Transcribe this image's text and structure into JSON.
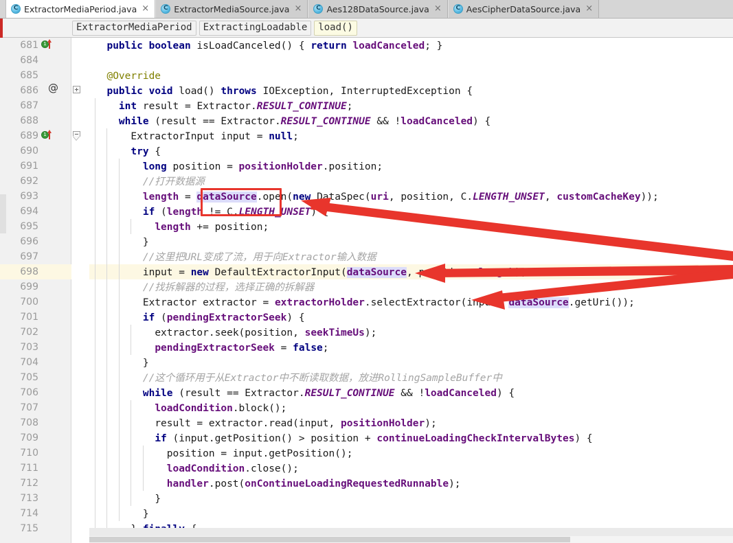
{
  "window": {
    "app": "IntelliJ IDEA Editor",
    "file": "ExtractorMediaPeriod.java"
  },
  "tabs": [
    {
      "label": "ExtractorMediaPeriod.java",
      "icon": "java-class-icon",
      "close": "×",
      "active": true
    },
    {
      "label": "ExtractorMediaSource.java",
      "icon": "java-class-icon",
      "close": "×",
      "active": false
    },
    {
      "label": "Aes128DataSource.java",
      "icon": "java-class-icon",
      "close": "×",
      "active": false
    },
    {
      "label": "AesCipherDataSource.java",
      "icon": "java-class-icon",
      "close": "×",
      "active": false
    }
  ],
  "breadcrumb": [
    {
      "label": "ExtractorMediaPeriod",
      "current": false
    },
    {
      "label": "ExtractingLoadable",
      "current": false
    },
    {
      "label": "load()",
      "current": true
    }
  ],
  "gutter": {
    "line_numbers": [
      "681",
      "684",
      "685",
      "686",
      "687",
      "688",
      "689",
      "690",
      "691",
      "692",
      "693",
      "694",
      "695",
      "696",
      "697",
      "698",
      "699",
      "700",
      "701",
      "702",
      "703",
      "704",
      "705",
      "706",
      "707",
      "708",
      "709",
      "710",
      "711",
      "712",
      "713",
      "714",
      "715"
    ],
    "icons": {
      "line_681": [
        "implementing-method-icon",
        "override-arrow-icon",
        "annotation-at-icon",
        "fold-expand-icon"
      ],
      "line_686": [
        "implementing-method-icon",
        "override-arrow-icon",
        "fold-collapse-icon"
      ]
    },
    "at_symbol": "@"
  },
  "code": {
    "lines": [
      {
        "n": "681",
        "indent": 0,
        "highlight": false,
        "text": "  public boolean isLoadCanceled() { return loadCanceled; }"
      },
      {
        "n": "684",
        "indent": 0,
        "highlight": false,
        "text": ""
      },
      {
        "n": "685",
        "indent": 0,
        "highlight": false,
        "text": "  @Override"
      },
      {
        "n": "686",
        "indent": 0,
        "highlight": false,
        "text": "  public void load() throws IOException, InterruptedException {"
      },
      {
        "n": "687",
        "indent": 1,
        "highlight": false,
        "text": "    int result = Extractor.RESULT_CONTINUE;"
      },
      {
        "n": "688",
        "indent": 1,
        "highlight": false,
        "text": "    while (result == Extractor.RESULT_CONTINUE && !loadCanceled) {"
      },
      {
        "n": "689",
        "indent": 2,
        "highlight": false,
        "text": "      ExtractorInput input = null;"
      },
      {
        "n": "690",
        "indent": 2,
        "highlight": false,
        "text": "      try {"
      },
      {
        "n": "691",
        "indent": 3,
        "highlight": false,
        "text": "        long position = positionHolder.position;"
      },
      {
        "n": "692",
        "indent": 3,
        "highlight": false,
        "text": "        //打开数据源"
      },
      {
        "n": "693",
        "indent": 3,
        "highlight": false,
        "text": "        length = dataSource.open(new DataSpec(uri, position, C.LENGTH_UNSET, customCacheKey));"
      },
      {
        "n": "694",
        "indent": 3,
        "highlight": false,
        "text": "        if (length != C.LENGTH_UNSET) {"
      },
      {
        "n": "695",
        "indent": 4,
        "highlight": false,
        "text": "          length += position;"
      },
      {
        "n": "696",
        "indent": 3,
        "highlight": false,
        "text": "        }"
      },
      {
        "n": "697",
        "indent": 3,
        "highlight": false,
        "text": "        //这里把URL变成了流，用于向Extractor输入数据"
      },
      {
        "n": "698",
        "indent": 3,
        "highlight": true,
        "text": "        input = new DefaultExtractorInput(dataSource, position, length);"
      },
      {
        "n": "699",
        "indent": 3,
        "highlight": false,
        "text": "        //找拆解器的过程，选择正确的拆解器"
      },
      {
        "n": "700",
        "indent": 3,
        "highlight": false,
        "text": "        Extractor extractor = extractorHolder.selectExtractor(input, dataSource.getUri());"
      },
      {
        "n": "701",
        "indent": 3,
        "highlight": false,
        "text": "        if (pendingExtractorSeek) {"
      },
      {
        "n": "702",
        "indent": 4,
        "highlight": false,
        "text": "          extractor.seek(position, seekTimeUs);"
      },
      {
        "n": "703",
        "indent": 4,
        "highlight": false,
        "text": "          pendingExtractorSeek = false;"
      },
      {
        "n": "704",
        "indent": 3,
        "highlight": false,
        "text": "        }"
      },
      {
        "n": "705",
        "indent": 3,
        "highlight": false,
        "text": "        //这个循环用于从Extractor中不断读取数据，放进RollingSampleBuffer中"
      },
      {
        "n": "706",
        "indent": 3,
        "highlight": false,
        "text": "        while (result == Extractor.RESULT_CONTINUE && !loadCanceled) {"
      },
      {
        "n": "707",
        "indent": 4,
        "highlight": false,
        "text": "          loadCondition.block();"
      },
      {
        "n": "708",
        "indent": 4,
        "highlight": false,
        "text": "          result = extractor.read(input, positionHolder);"
      },
      {
        "n": "709",
        "indent": 4,
        "highlight": false,
        "text": "          if (input.getPosition() > position + continueLoadingCheckIntervalBytes) {"
      },
      {
        "n": "710",
        "indent": 5,
        "highlight": false,
        "text": "            position = input.getPosition();"
      },
      {
        "n": "711",
        "indent": 5,
        "highlight": false,
        "text": "            loadCondition.close();"
      },
      {
        "n": "712",
        "indent": 5,
        "highlight": false,
        "text": "            handler.post(onContinueLoadingRequestedRunnable);"
      },
      {
        "n": "713",
        "indent": 4,
        "highlight": false,
        "text": "          }"
      },
      {
        "n": "714",
        "indent": 3,
        "highlight": false,
        "text": "        }"
      },
      {
        "n": "715",
        "indent": 2,
        "highlight": false,
        "text": "      } finally {"
      }
    ]
  },
  "annotations": {
    "red_box_target": "dataSource",
    "arrows": [
      {
        "from": "right-edge",
        "to": "dataSource-open-call",
        "color": "#e8352c"
      },
      {
        "from": "right-edge",
        "to": "dataSource-extractor-input-arg",
        "color": "#e8352c"
      },
      {
        "from": "right-edge",
        "to": "dataSource-get-uri-call",
        "color": "#e8352c"
      }
    ]
  },
  "colors": {
    "keyword": "#000080",
    "field": "#660e7a",
    "comment": "#a4a4a4",
    "annotation": "#808000",
    "highlight_line": "#fdf8e3",
    "occurrence": "#dcdcfa",
    "accent_red": "#e8352c",
    "tab_active_bg": "#ffffff",
    "tab_inactive_bg": "#cfcfcf",
    "gutter_bg": "#f1f1f1"
  }
}
